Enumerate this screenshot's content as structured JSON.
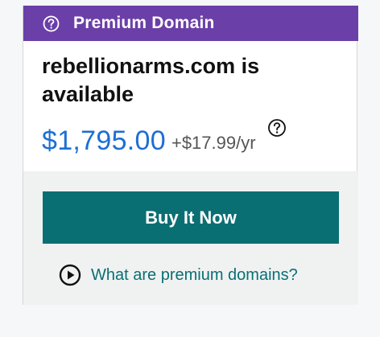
{
  "banner": {
    "label": "Premium Domain",
    "icon": "question-circle-icon",
    "color": "#6b3fa8"
  },
  "domain": {
    "headline": "rebellionarms.com is available",
    "price": "$1,795.00",
    "renewal": "+$17.99/yr",
    "help_icon": "question-circle-icon",
    "price_color": "#1c6fd3"
  },
  "actions": {
    "buy_label": "Buy It Now",
    "buy_color": "#0a6f73",
    "learn_label": "What are premium domains?",
    "learn_icon": "play-circle-icon"
  }
}
